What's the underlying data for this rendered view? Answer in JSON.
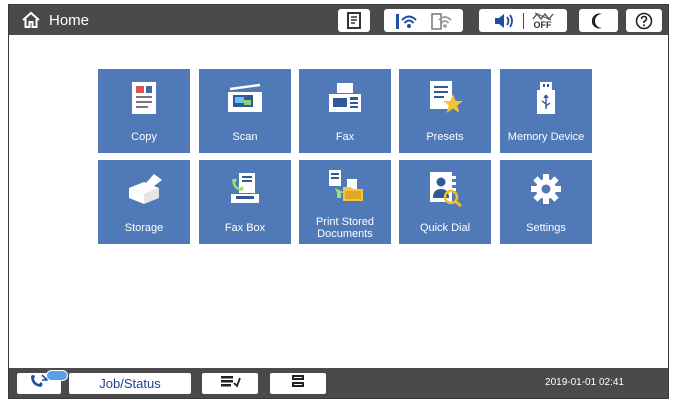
{
  "header": {
    "home_label": "Home",
    "status_icons": [
      "document-icon",
      "wifi-icon",
      "wifi-direct-icon",
      "speaker-icon",
      "sound-off-icon",
      "sleep-icon",
      "help-icon"
    ],
    "sound_off_text": "OFF"
  },
  "tiles": [
    {
      "label": "Copy",
      "icon": "copy-icon"
    },
    {
      "label": "Scan",
      "icon": "scan-icon"
    },
    {
      "label": "Fax",
      "icon": "fax-icon"
    },
    {
      "label": "Presets",
      "icon": "presets-icon"
    },
    {
      "label": "Memory Device",
      "icon": "memory-device-icon"
    },
    {
      "label": "Storage",
      "icon": "storage-icon"
    },
    {
      "label": "Fax Box",
      "icon": "fax-box-icon"
    },
    {
      "label": "Print Stored\nDocuments",
      "label_line1": "Print Stored",
      "label_line2": "Documents",
      "icon": "print-stored-documents-icon"
    },
    {
      "label": "Quick Dial",
      "icon": "quick-dial-icon"
    },
    {
      "label": "Settings",
      "icon": "settings-icon"
    }
  ],
  "footer": {
    "job_status_label": "Job/Status",
    "datetime": "2019-01-01 02:41",
    "icons": [
      "phone-fax-icon",
      "transfer-icon",
      "stop-icon"
    ]
  },
  "colors": {
    "tile_bg": "#4f79b7",
    "bar_bg": "#4a4a4a",
    "job_status_text": "#1f3f8f",
    "quick_dial_magnifier": "#f0c020",
    "presets_star": "#f4c430"
  }
}
